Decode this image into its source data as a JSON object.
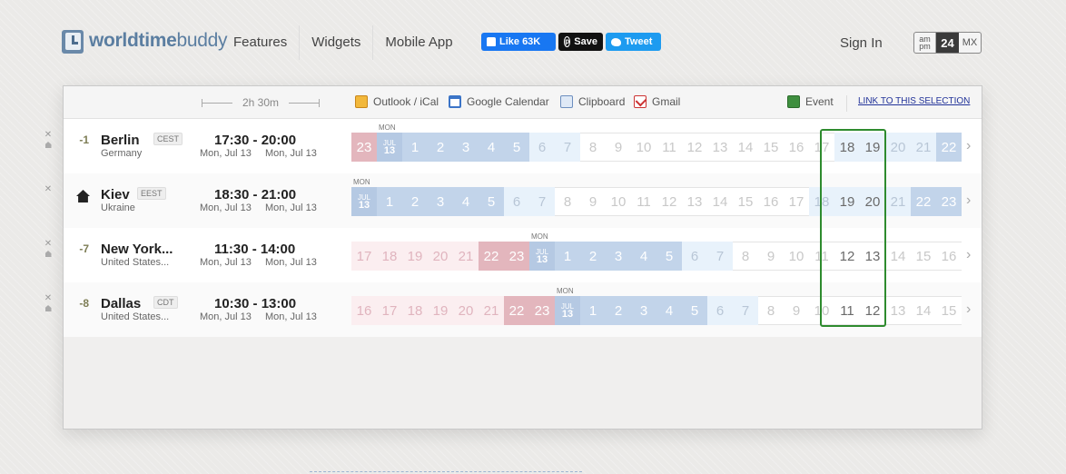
{
  "nav": {
    "logo_prefix": "worldtime",
    "logo_suffix": "buddy",
    "links": [
      "Features",
      "Widgets",
      "Mobile App"
    ],
    "fb_label": "Like 63K",
    "pin_label": "Save",
    "tw_label": "Tweet",
    "signin": "Sign In",
    "fmt": {
      "am": "am",
      "pm": "pm",
      "h24": "24",
      "mx": "MX"
    }
  },
  "toolbar": {
    "duration": "2h 30m",
    "outlook": "Outlook / iCal",
    "gcal": "Google Calendar",
    "clipboard": "Clipboard",
    "gmail": "Gmail",
    "event": "Event",
    "link": "LINK TO THIS SELECTION"
  },
  "colors": {
    "accent": "#2e8b2e",
    "link": "#223399"
  },
  "rows": [
    {
      "offset": "-1",
      "city": "Berlin",
      "abbr": "CEST",
      "country": "Germany",
      "time_range": "17:30 - 20:00",
      "date_from": "Mon, Jul 13",
      "date_to": "Mon, Jul 13",
      "mon": "MON",
      "mon_index": 1,
      "hours": [
        "23",
        "JUL|13",
        "1",
        "2",
        "3",
        "4",
        "5",
        "6",
        "7",
        "8",
        "9",
        "10",
        "11",
        "12",
        "13",
        "14",
        "15",
        "16",
        "17",
        "18",
        "19",
        "20",
        "21",
        "22"
      ]
    },
    {
      "offset": "",
      "home": true,
      "city": "Kiev",
      "abbr": "EEST",
      "country": "Ukraine",
      "time_range": "18:30 - 21:00",
      "date_from": "Mon, Jul 13",
      "date_to": "Mon, Jul 13",
      "mon": "MON",
      "mon_index": 0,
      "hours": [
        "JUL|13",
        "1",
        "2",
        "3",
        "4",
        "5",
        "6",
        "7",
        "8",
        "9",
        "10",
        "11",
        "12",
        "13",
        "14",
        "15",
        "16",
        "17",
        "18",
        "19",
        "20",
        "21",
        "22",
        "23"
      ]
    },
    {
      "offset": "-7",
      "city": "New York...",
      "abbr": "",
      "country": "United States...",
      "time_range": "11:30 - 14:00",
      "date_from": "Mon, Jul 13",
      "date_to": "Mon, Jul 13",
      "mon": "MON",
      "mon_index": 7,
      "hours": [
        "17",
        "18",
        "19",
        "20",
        "21",
        "22",
        "23",
        "JUL|13",
        "1",
        "2",
        "3",
        "4",
        "5",
        "6",
        "7",
        "8",
        "9",
        "10",
        "11",
        "12",
        "13",
        "14",
        "15",
        "16"
      ]
    },
    {
      "offset": "-8",
      "city": "Dallas",
      "abbr": "CDT",
      "country": "United States...",
      "time_range": "10:30 - 13:00",
      "date_from": "Mon, Jul 13",
      "date_to": "Mon, Jul 13",
      "mon": "MON",
      "mon_index": 8,
      "hours": [
        "16",
        "17",
        "18",
        "19",
        "20",
        "21",
        "22",
        "23",
        "JUL|13",
        "1",
        "2",
        "3",
        "4",
        "5",
        "6",
        "7",
        "8",
        "9",
        "10",
        "11",
        "12",
        "13",
        "14",
        "15"
      ]
    }
  ]
}
